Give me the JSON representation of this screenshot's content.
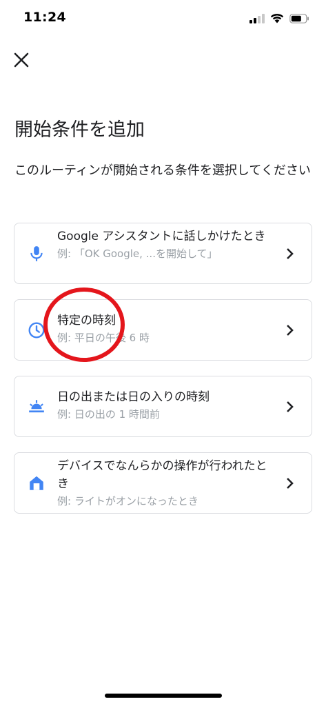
{
  "status_bar": {
    "time": "11:24"
  },
  "header": {
    "close_icon": "close-icon"
  },
  "page": {
    "title": "開始条件を追加",
    "subtitle": "このルーティンが開始される条件を選択してください"
  },
  "options": [
    {
      "icon": "microphone-icon",
      "title": "Google アシスタントに話しかけたとき",
      "example": "例: 「OK Google, ...を開始して」"
    },
    {
      "icon": "clock-icon",
      "title": "特定の時刻",
      "example": "例: 平日の午後 6 時"
    },
    {
      "icon": "sunrise-icon",
      "title": "日の出または日の入りの時刻",
      "example": "例: 日の出の 1 時間前"
    },
    {
      "icon": "home-icon",
      "title": "デバイスでなんらかの操作が行われたとき",
      "example": "例: ライトがオンになったとき"
    }
  ],
  "colors": {
    "icon_blue": "#4285f4",
    "annotation_red": "#e4161c",
    "card_border": "#dadce0",
    "secondary_text": "#9aa0a6"
  }
}
